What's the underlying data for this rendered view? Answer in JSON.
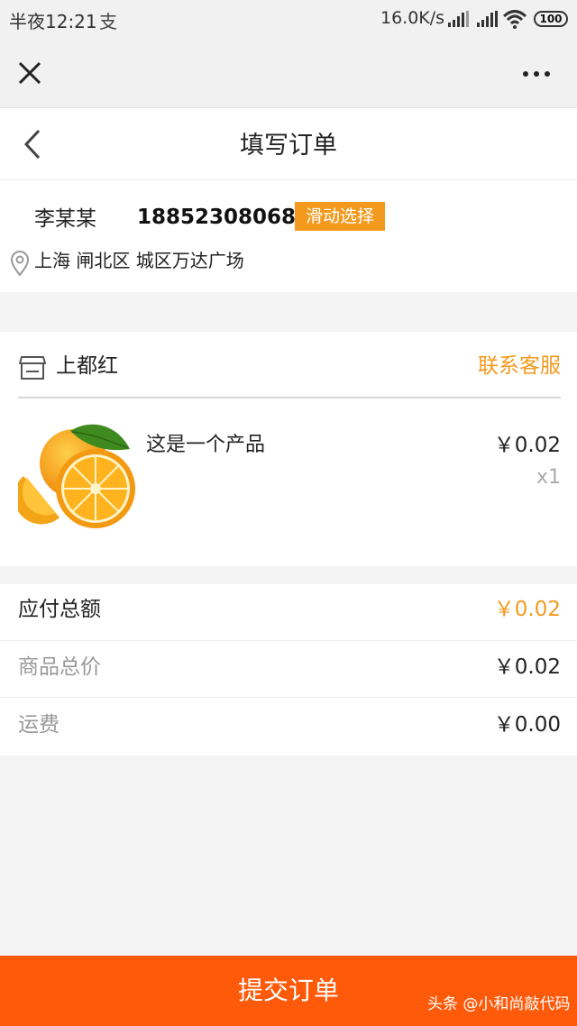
{
  "status_bar": {
    "time": "半夜12:21",
    "alipay_glyph": "支",
    "net_speed": "16.0K/s",
    "battery": "100",
    "icons": [
      "signal-icon",
      "signal-icon",
      "wifi-icon",
      "battery-icon"
    ]
  },
  "webview": {
    "close_icon": "close-icon",
    "more_icon": "more-icon"
  },
  "header": {
    "title": "填写订单",
    "back_icon": "chevron-left-icon"
  },
  "address": {
    "name": "李某某",
    "phone": "18852308068",
    "select_button": "滑动选择",
    "location": "上海 闸北区 城区万达广场",
    "pin_icon": "location-pin-icon"
  },
  "store": {
    "name": "上都红",
    "contact": "联系客服",
    "icon": "store-icon",
    "product": {
      "name": "这是一个产品",
      "price": "￥0.02",
      "quantity": "x1",
      "image": "orange-image"
    }
  },
  "summary": {
    "total_label": "应付总额",
    "total_value": "￥0.02",
    "goods_label": "商品总价",
    "goods_value": "￥0.02",
    "shipping_label": "运费",
    "shipping_value": "￥0.00"
  },
  "submit_label": "提交订单",
  "watermark": "头条 @小和尚敲代码",
  "colors": {
    "accent_orange": "#f39a1e",
    "submit_bg": "#ff5a0a",
    "background": "#f4f4f4"
  }
}
